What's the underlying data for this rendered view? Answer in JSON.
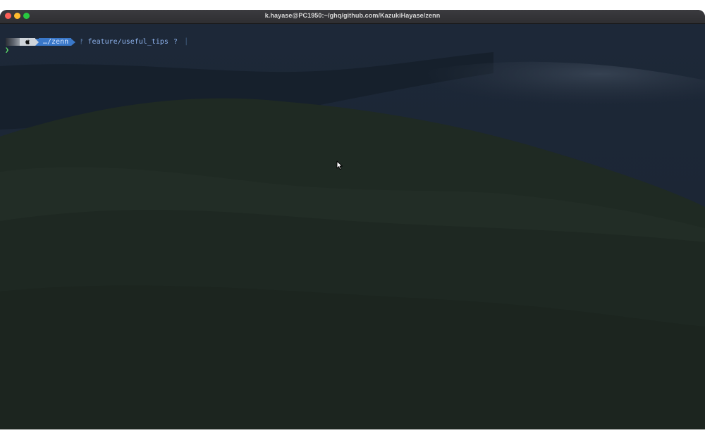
{
  "window": {
    "title": "k.hayase@PC1950:~/ghq/github.com/KazukiHayase/zenn"
  },
  "traffic_lights": {
    "close_color": "#fe5f57",
    "minimize_color": "#febc2e",
    "maximize_color": "#28c840"
  },
  "prompt": {
    "os_icon": "apple-icon",
    "directory": "…/zenn",
    "branch_icon": "git-branch-icon",
    "branch": "feature/useful_tips",
    "git_status": "?",
    "input_caret": "❯"
  },
  "colors": {
    "dir_segment": "#3a78c9",
    "caret": "#5ee06b",
    "background": "#1b2532"
  }
}
